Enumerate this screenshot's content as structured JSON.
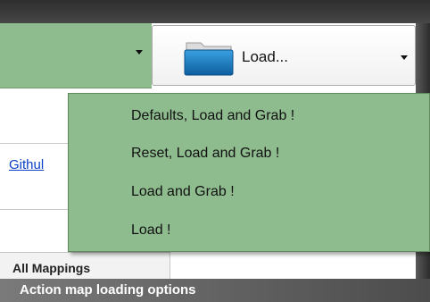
{
  "toolbar": {
    "load_button_label": "Load..."
  },
  "page": {
    "link_text": "Githul",
    "tab_label": "All Mappings"
  },
  "load_menu": {
    "items": [
      {
        "label": "Defaults, Load and Grab !"
      },
      {
        "label": "Reset, Load and Grab !"
      },
      {
        "label": "Load and Grab !"
      },
      {
        "label": "Load !"
      }
    ]
  },
  "caption": "Action map loading options",
  "colors": {
    "menu_background": "#8fbc8f",
    "folder_blue": "#1f7fc2"
  },
  "icons": {
    "load": "folder-icon",
    "dropdown": "chevron-down-icon"
  }
}
